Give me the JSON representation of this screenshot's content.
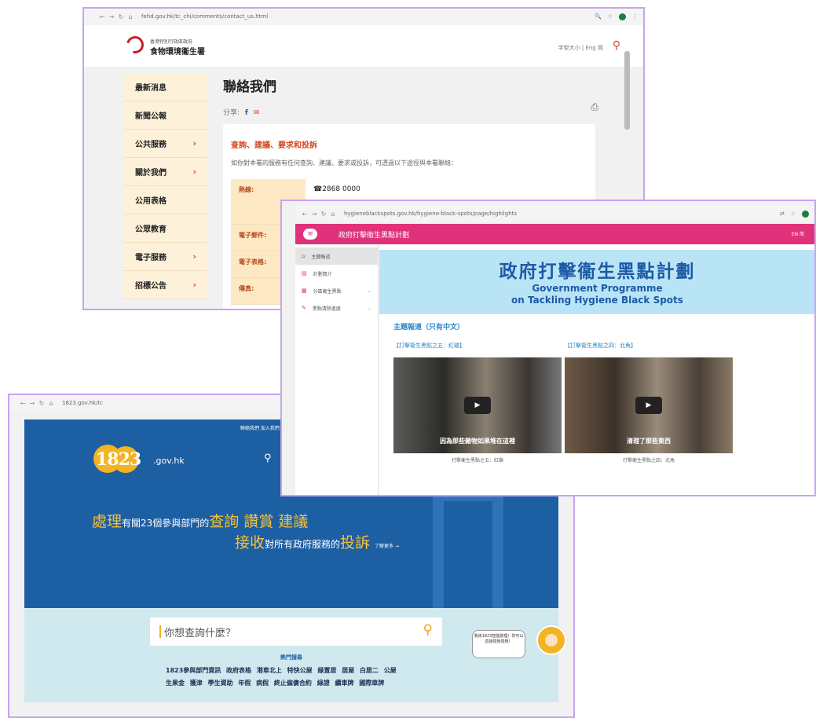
{
  "fehd": {
    "url": "fehd.gov.hk/tc_chi/comments/contact_us.html",
    "org_line1": "香港特別行政區政府",
    "org_line2": "食物環境衞生署",
    "tools": "字型大小 | Eng 简",
    "sidebar": [
      {
        "label": "最新消息",
        "chevron": false
      },
      {
        "label": "新聞公報",
        "chevron": false
      },
      {
        "label": "公共服務",
        "chevron": true
      },
      {
        "label": "關於我們",
        "chevron": true
      },
      {
        "label": "公用表格",
        "chevron": false
      },
      {
        "label": "公眾教育",
        "chevron": false
      },
      {
        "label": "電子服務",
        "chevron": true
      },
      {
        "label": "招標公告",
        "chevron": true
      }
    ],
    "page_title": "聯絡我們",
    "share_label": "分享:",
    "card_title": "查詢、建議、要求和投訴",
    "card_desc": "如你對本署的服務有任何查詢、建議、要求或投訴，可透過以下途徑與本署聯絡：",
    "rows": [
      {
        "label": "熱線:",
        "value": "☎2868 0000"
      },
      {
        "label": "電子郵件:",
        "value": ""
      },
      {
        "label": "電子表格:",
        "value": ""
      },
      {
        "label": "傳真:",
        "value": ""
      }
    ]
  },
  "hygiene": {
    "url": "hygieneblackspots.gov.hk/hygiene-black-spots/page/highlights",
    "title": "政府打擊衞生黑點計劃",
    "lang": "EN  简",
    "nav": [
      {
        "label": "主題報道",
        "active": true,
        "chevron": false
      },
      {
        "label": "計劃簡介",
        "active": false,
        "chevron": false
      },
      {
        "label": "分區衞生黑點",
        "active": false,
        "chevron": true
      },
      {
        "label": "黑點清除進度",
        "active": false,
        "chevron": true
      }
    ],
    "banner_zh": "政府打擊衞生黑點計劃",
    "banner_en1": "Government Programme",
    "banner_en2": "on Tackling Hygiene Black Spots",
    "section_title": "主題報道（只有中文）",
    "videos": [
      {
        "title": "【打擊衞生黑點之五：紅磡】",
        "caption": "因為那些雜物如果堆在這裡",
        "subtitle": "打擊衞生黑點之五：紅磡"
      },
      {
        "title": "【打擊衞生黑點之四：北角】",
        "caption": "清理了那些東西",
        "subtitle": "打擊衞生黑點之四：北角"
      }
    ]
  },
  "site1823": {
    "url": "1823.gov.hk/tc",
    "top_links": "聯絡我們   加入我們",
    "logo_text": "1823",
    "gov_hk": ".gov.hk",
    "headline1_prefix": "處理",
    "headline1_mid": "有關23個參與部門的",
    "headline1_big": "查詢 讚賞 建議",
    "headline2_prefix": "接收",
    "headline2_mid": "對所有政府服務的",
    "headline2_big": "投訴",
    "more": "了解更多 →",
    "search_placeholder": "你想查詢什麼？",
    "hot_title": "熱門搜尋",
    "hot_line1": "1823參與部門資訊 政府表格 港車北上 特快公屋 綠置居 居屋 白居二 公屋",
    "hot_line2": "生果金 獲津 學生資助 年假 病假 終止僱傭合約 綠證 續車牌 國際車牌",
    "bubble": "我係1823智能助理！你可以直接問我問題！"
  }
}
